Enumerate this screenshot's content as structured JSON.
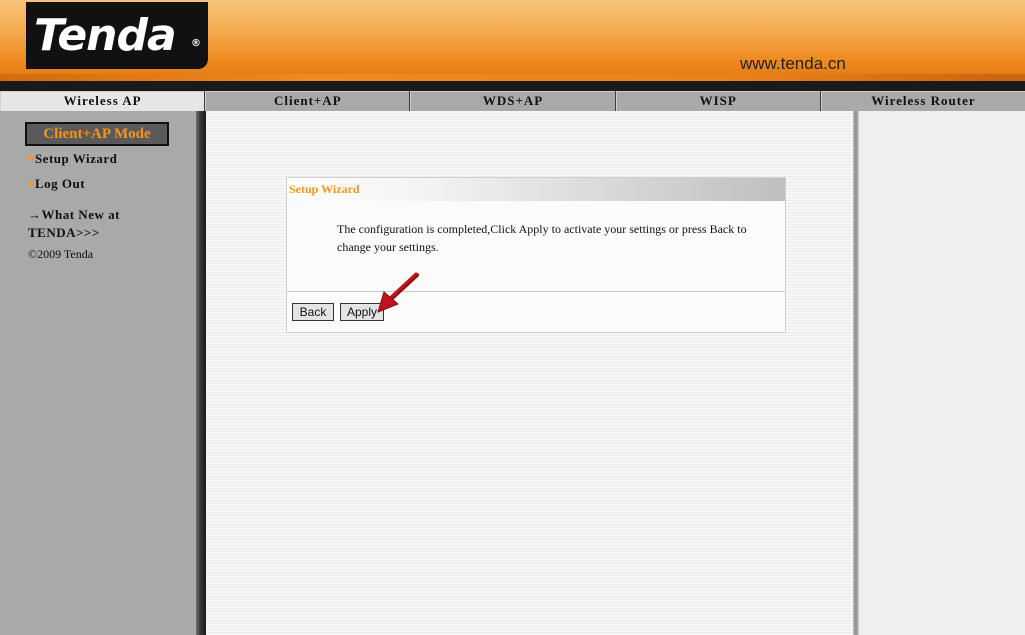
{
  "header": {
    "logo_text": "Tenda",
    "logo_mark": "®",
    "url": "www.tenda.cn"
  },
  "tabs": [
    {
      "label": "Wireless AP",
      "active": true
    },
    {
      "label": "Client+AP",
      "active": false
    },
    {
      "label": "WDS+AP",
      "active": false
    },
    {
      "label": "WISP",
      "active": false
    },
    {
      "label": "Wireless Router",
      "active": false
    }
  ],
  "sidebar": {
    "mode_title": "Client+AP Mode",
    "links": [
      {
        "label": "Setup Wizard"
      },
      {
        "label": "Log Out"
      }
    ],
    "whats_new": "→What New at TENDA>>>",
    "copyright": "©2009 Tenda"
  },
  "panel": {
    "title": "Setup Wizard",
    "message": "The configuration is completed,Click Apply to activate your settings or press Back to change your settings.",
    "back_label": "Back",
    "apply_label": "Apply"
  },
  "colors": {
    "accent_orange": "#f7941d",
    "header_orange": "#ee8a20",
    "annotation_arrow": "#c0141c"
  },
  "icons": {
    "bullet": "orange-bullet-icon",
    "annotation": "red-arrow-icon"
  }
}
